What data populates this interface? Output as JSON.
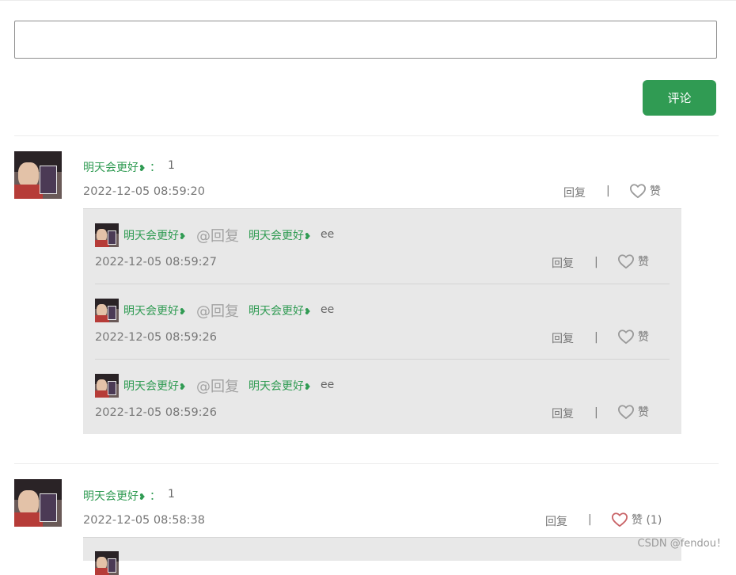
{
  "comment_form": {
    "input_value": "",
    "submit_label": "评论"
  },
  "comments": [
    {
      "author": "明天会更好",
      "colon": "：",
      "content": "1",
      "time": "2022-12-05 08:59:20",
      "reply_label": "回复",
      "separator": "|",
      "like_label": "赞",
      "liked": false,
      "replies": [
        {
          "author": "明天会更好",
          "at_text": "@回复",
          "target": "明天会更好",
          "content": "ee",
          "time": "2022-12-05 08:59:27",
          "reply_label": "回复",
          "separator": "|",
          "like_label": "赞"
        },
        {
          "author": "明天会更好",
          "at_text": "@回复",
          "target": "明天会更好",
          "content": "ee",
          "time": "2022-12-05 08:59:26",
          "reply_label": "回复",
          "separator": "|",
          "like_label": "赞"
        },
        {
          "author": "明天会更好",
          "at_text": "@回复",
          "target": "明天会更好",
          "content": "ee",
          "time": "2022-12-05 08:59:26",
          "reply_label": "回复",
          "separator": "|",
          "like_label": "赞"
        }
      ]
    },
    {
      "author": "明天会更好",
      "colon": "：",
      "content": "1",
      "time": "2022-12-05 08:58:38",
      "reply_label": "回复",
      "separator": "|",
      "like_label": "赞 (1)",
      "liked": true
    }
  ],
  "leaf_glyph": "❥",
  "watermark": "CSDN @fendou！",
  "colors": {
    "accent": "#309b53",
    "heart_gray": "#9a9a9a",
    "heart_liked": "#c96468",
    "reply_bg": "#e8e8e8"
  }
}
